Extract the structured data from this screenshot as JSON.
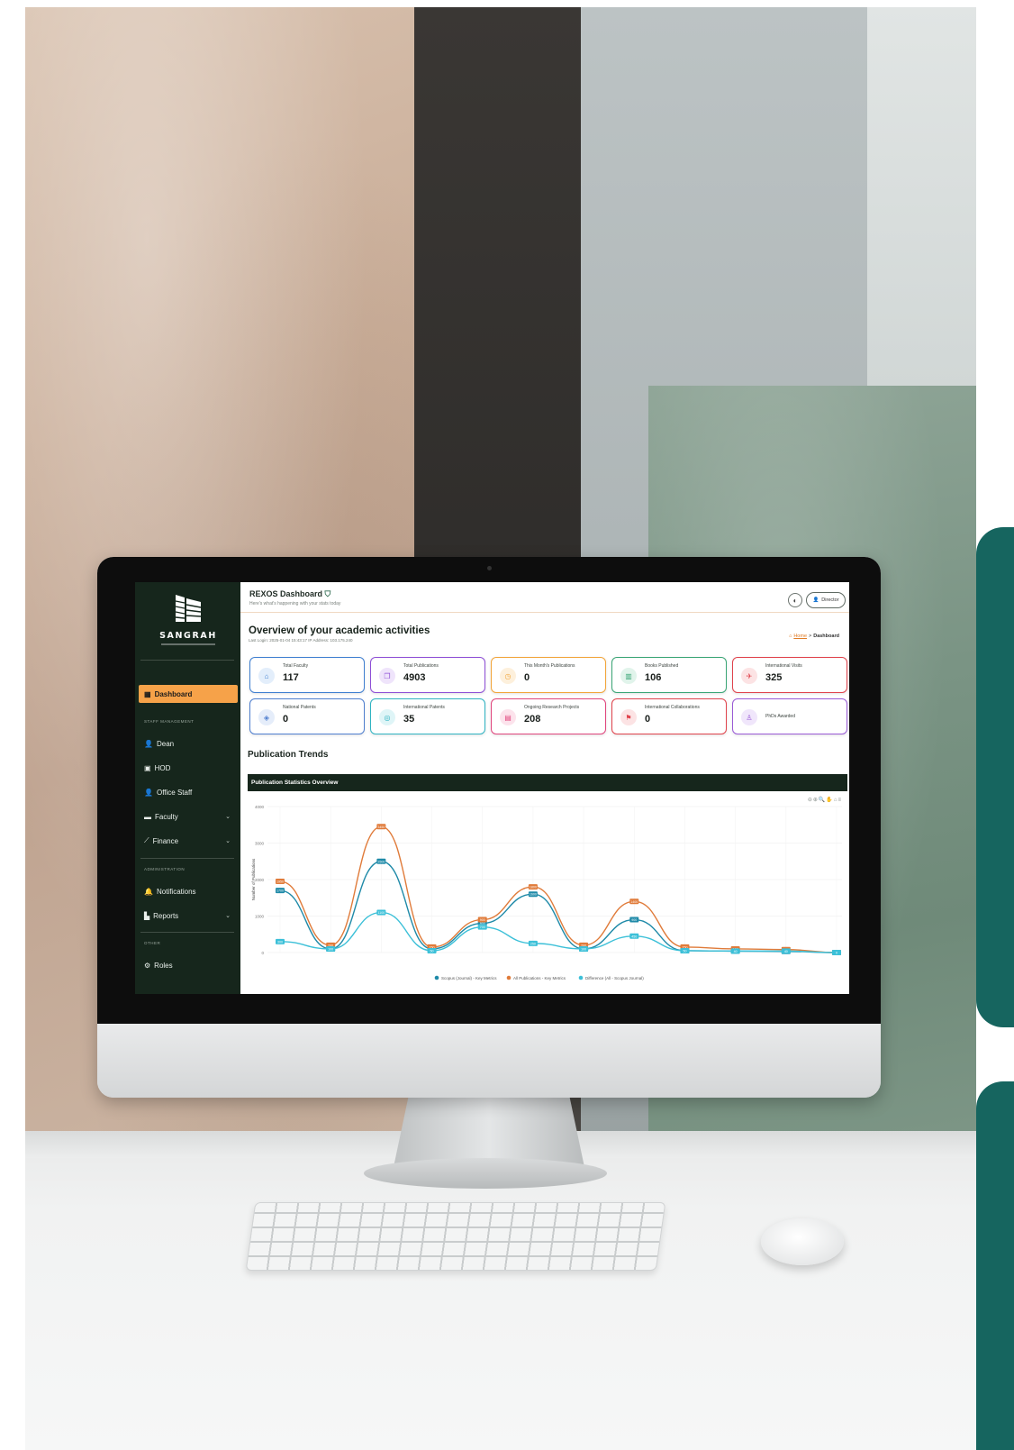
{
  "app": {
    "brand": "SANGRAH",
    "title": "REXOS Dashboard",
    "subtitle": "Here's what's happening with your stats today",
    "user_button": "Director"
  },
  "sidebar": {
    "active_item": "Dashboard",
    "sections": [
      {
        "label": "STAFF MANAGEMENT",
        "items": [
          {
            "label": "Dean",
            "icon": "user-icon",
            "expandable": false
          },
          {
            "label": "HOD",
            "icon": "id-card-icon",
            "expandable": false
          },
          {
            "label": "Office Staff",
            "icon": "user-icon",
            "expandable": false
          },
          {
            "label": "Faculty",
            "icon": "folder-icon",
            "expandable": true
          },
          {
            "label": "Finance",
            "icon": "chart-line-icon",
            "expandable": true
          }
        ]
      },
      {
        "label": "ADMINISTRATION",
        "items": [
          {
            "label": "Notifications",
            "icon": "bell-icon",
            "expandable": false
          },
          {
            "label": "Reports",
            "icon": "report-icon",
            "expandable": true
          }
        ]
      },
      {
        "label": "OTHER",
        "items": [
          {
            "label": "Roles",
            "icon": "gear-icon",
            "expandable": false
          }
        ]
      }
    ]
  },
  "overview": {
    "title": "Overview of your academic activities",
    "last_login": "Last Login: 2025-01-04 15:43:17 IP Address: 103.175.240",
    "breadcrumb_home": "Home",
    "breadcrumb_sep": ">",
    "breadcrumb_current": "Dashboard"
  },
  "stats": [
    {
      "label": "Total Faculty",
      "value": "117",
      "color": "#3f7fd1",
      "bg": "#e3eefb",
      "icon": "building-icon",
      "glyph": "⌂"
    },
    {
      "label": "Total Publications",
      "value": "4903",
      "color": "#8e4fd6",
      "bg": "#efe4fb",
      "icon": "book-icon",
      "glyph": "❐"
    },
    {
      "label": "This Month's Publications",
      "value": "0",
      "color": "#f2a53a",
      "bg": "#fdf0dc",
      "icon": "clock-icon",
      "glyph": "◷"
    },
    {
      "label": "Books Published",
      "value": "106",
      "color": "#3aa676",
      "bg": "#e1f4eb",
      "icon": "books-icon",
      "glyph": "▥"
    },
    {
      "label": "International Visits",
      "value": "325",
      "color": "#e0434c",
      "bg": "#fce3e4",
      "icon": "plane-icon",
      "glyph": "✈"
    },
    {
      "label": "National Patents",
      "value": "0",
      "color": "#4f7fcf",
      "bg": "#e5edfa",
      "icon": "shield-icon",
      "glyph": "◈"
    },
    {
      "label": "International Patents",
      "value": "35",
      "color": "#2fb3c2",
      "bg": "#dff5f7",
      "icon": "globe-icon",
      "glyph": "◎"
    },
    {
      "label": "Ongoing Research Projects",
      "value": "208",
      "color": "#e0457d",
      "bg": "#fce3ec",
      "icon": "clipboard-icon",
      "glyph": "▤"
    },
    {
      "label": "International Collaborations",
      "value": "0",
      "color": "#e0434c",
      "bg": "#fce3e4",
      "icon": "handshake-icon",
      "glyph": "⚑"
    },
    {
      "label": "PhDs Awarded",
      "value": "",
      "color": "#9a5ad6",
      "bg": "#f0e6fb",
      "icon": "graduate-icon",
      "glyph": "♙"
    }
  ],
  "publication_trends": {
    "title": "Publication Trends",
    "panel_title": "Publication Statistics Overview",
    "tools": "⊖⊕🔍✋⌂≡"
  },
  "chart_data": {
    "type": "line",
    "title": "Publication Statistics Overview",
    "ylabel": "Number of Publications",
    "ylim": [
      0,
      4000
    ],
    "yticks": [
      "4000",
      "3000",
      "2000",
      "1000",
      "0"
    ],
    "series": [
      {
        "name": "Scopus (Journal) - Key Metrics",
        "color": "#1f8aa8",
        "values": [
          1700,
          100,
          2500,
          100,
          800,
          1600,
          100,
          900,
          50,
          40,
          30,
          0
        ]
      },
      {
        "name": "All Publications - Key Metrics",
        "color": "#e07b3a",
        "values": [
          1950,
          200,
          3450,
          150,
          900,
          1800,
          200,
          1400,
          150,
          100,
          80,
          0
        ]
      },
      {
        "name": "Difference (All - Scopus Journal)",
        "color": "#3cc0d8",
        "values": [
          300,
          100,
          1100,
          50,
          700,
          250,
          100,
          450,
          50,
          40,
          40,
          0
        ]
      }
    ]
  }
}
